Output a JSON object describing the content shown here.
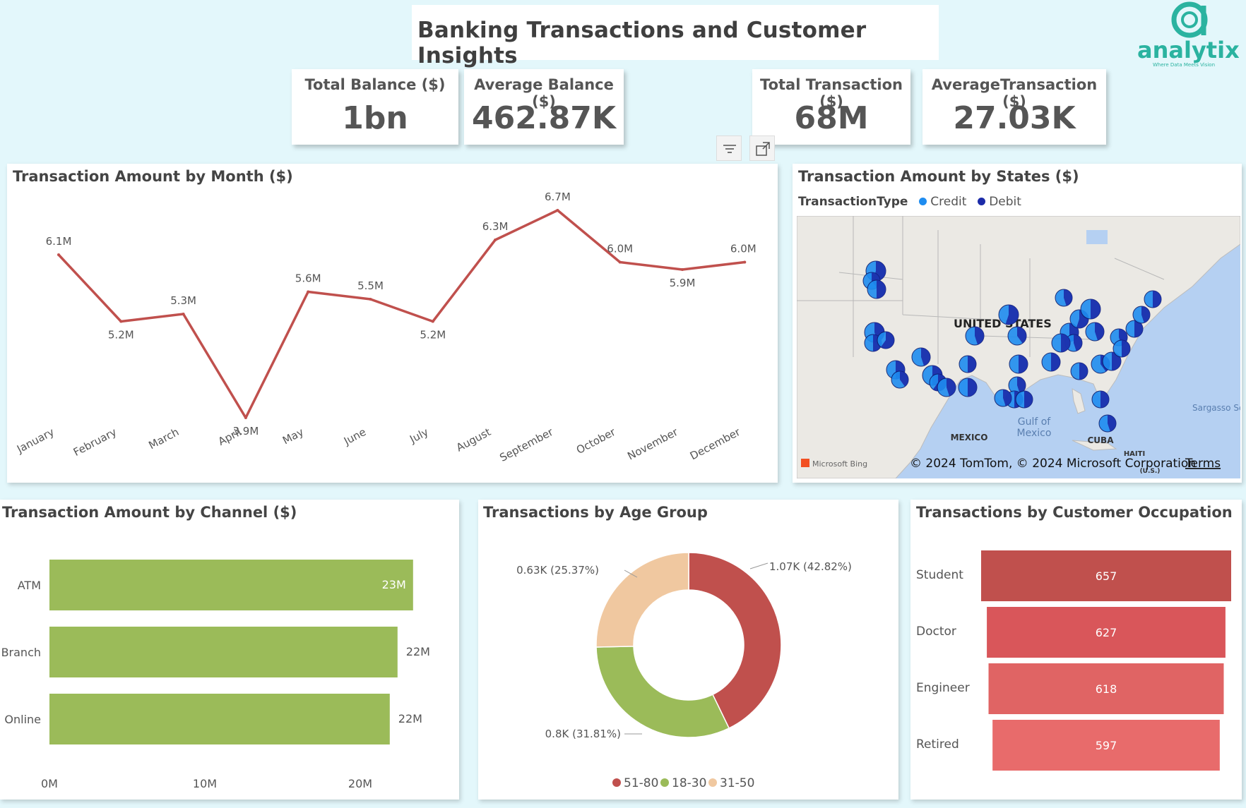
{
  "header": {
    "title": "Banking Transactions and Customer Insights"
  },
  "logo": {
    "name": "analytix",
    "tagline": "Where Data Meets Vision",
    "color": "#2bb3a0"
  },
  "kpis": [
    {
      "label": "Total Balance ($)",
      "value": "1bn"
    },
    {
      "label": "Average Balance ($)",
      "value": "462.87K"
    },
    {
      "label": "Total Transaction ($)",
      "value": "68M"
    },
    {
      "label": "AverageTransaction ($)",
      "value": "27.03K"
    }
  ],
  "toolbar": {
    "filter_icon": "filter-icon",
    "focus_icon": "focus-mode-icon"
  },
  "map": {
    "title": "Transaction Amount by States ($)",
    "legend_title": "TransactionType",
    "legend": [
      {
        "name": "Credit",
        "color": "#1e8cf0"
      },
      {
        "name": "Debit",
        "color": "#1c2ba8"
      }
    ],
    "labels": {
      "country": "UNITED STATES",
      "gulf": "Gulf of",
      "gulf2": "Mexico",
      "mexico": "MEXICO",
      "cuba": "CUBA",
      "sargasso": "Sargasso Sea",
      "haiti": "HAITI",
      "us_small": "(U.S.)"
    },
    "attribution": "© 2024 TomTom, © 2024 Microsoft Corporation",
    "terms": "Terms",
    "bing": "Microsoft Bing"
  },
  "chart_data": [
    {
      "type": "line",
      "title": "Transaction Amount by Month ($)",
      "categories": [
        "January",
        "February",
        "March",
        "April",
        "May",
        "June",
        "July",
        "August",
        "September",
        "October",
        "November",
        "December"
      ],
      "values": [
        6.1,
        5.2,
        5.3,
        3.9,
        5.6,
        5.5,
        5.2,
        6.3,
        6.7,
        6.0,
        5.9,
        6.0
      ],
      "data_labels": [
        "6.1M",
        "5.2M",
        "5.3M",
        "3.9M",
        "5.6M",
        "5.5M",
        "5.2M",
        "6.3M",
        "6.7M",
        "6.0M",
        "5.9M",
        "6.0M"
      ],
      "unit": "M",
      "color": "#c0504d"
    },
    {
      "type": "bar",
      "orientation": "horizontal",
      "title": "Transaction Amount by Channel ($)",
      "categories": [
        "ATM",
        "Branch",
        "Online"
      ],
      "values": [
        23.4,
        22.4,
        21.9
      ],
      "data_labels": [
        "23M",
        "22M",
        "22M"
      ],
      "xticks": [
        "0M",
        "10M",
        "20M"
      ],
      "xlim": [
        0,
        20
      ],
      "color": "#9bbb59"
    },
    {
      "type": "pie",
      "subtype": "donut",
      "title": "Transactions by Age Group",
      "categories": [
        "51-80",
        "18-30",
        "31-50"
      ],
      "values": [
        42.82,
        31.81,
        25.37
      ],
      "data_labels": [
        "1.07K (42.82%)",
        "0.8K (31.81%)",
        "0.63K (25.37%)"
      ],
      "colors": [
        "#c0504d",
        "#9bbb59",
        "#f0c8a0"
      ]
    },
    {
      "type": "bar",
      "orientation": "funnel",
      "title": "Transactions by Customer Occupation",
      "categories": [
        "Student",
        "Doctor",
        "Engineer",
        "Retired"
      ],
      "values": [
        657,
        627,
        618,
        597
      ],
      "colors": [
        "#c0504d",
        "#d9565a",
        "#e06464",
        "#e86b6b"
      ]
    }
  ]
}
